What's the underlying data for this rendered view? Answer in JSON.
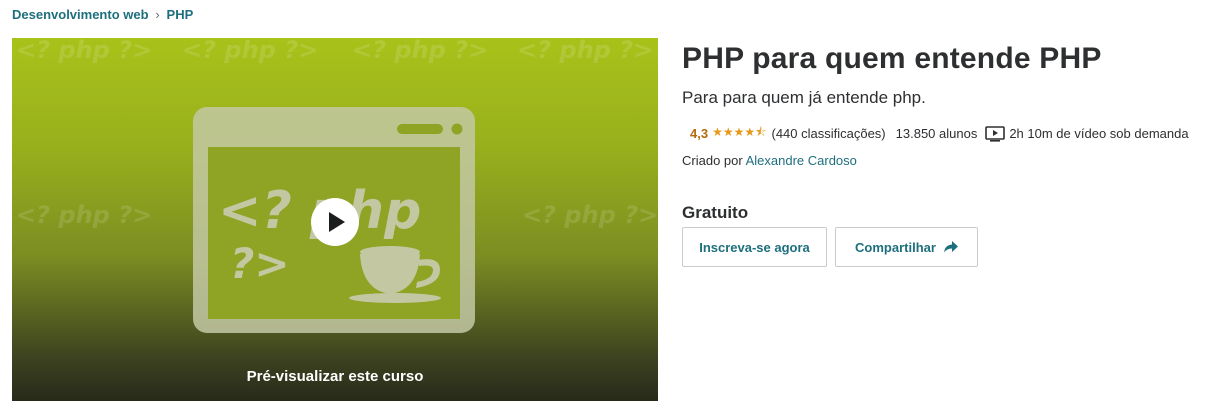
{
  "breadcrumb": {
    "category": "Desenvolvimento web",
    "separator": "›",
    "subcategory": "PHP"
  },
  "preview": {
    "label": "Pré-visualizar este curso",
    "bg_text": "<? php ?>",
    "php_open": "<? php",
    "php_close": "?>"
  },
  "course": {
    "title": "PHP para quem entende PHP",
    "subtitle": "Para para quem já entende php.",
    "rating": "4,3",
    "stars": "★★★★⯪",
    "stars_value": 4.3,
    "reviews": "(440 classificações)",
    "students": "13.850 alunos",
    "video_length": "2h 10m de vídeo sob demanda",
    "created_by_label": "Criado por",
    "author": "Alexandre Cardoso",
    "price": "Gratuito"
  },
  "buttons": {
    "enroll": "Inscreva-se agora",
    "share": "Compartilhar"
  },
  "colors": {
    "link": "#1e6f7e",
    "rating": "#b4690e",
    "stars": "#e59819",
    "preview_top": "#a9c21a",
    "preview_bottom": "#282a1a"
  },
  "icons": [
    "chevron-right-icon",
    "play-icon",
    "video-icon",
    "share-arrow-icon",
    "coffee-cup-icon",
    "browser-window-icon"
  ]
}
